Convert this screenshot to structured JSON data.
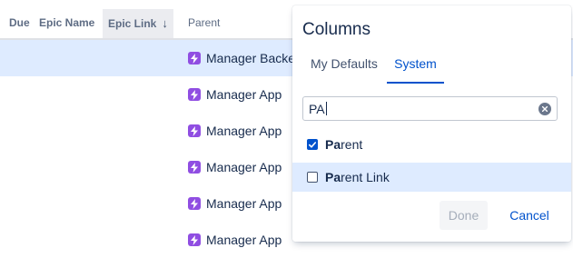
{
  "table": {
    "headers": {
      "due": "Due",
      "epic_name": "Epic Name",
      "epic_link": "Epic Link",
      "epic_link_sort": "↓",
      "parent": "Parent"
    },
    "rows": [
      {
        "parent": "Manager Backe",
        "selected": true
      },
      {
        "parent": "Manager App"
      },
      {
        "parent": "Manager App"
      },
      {
        "parent": "Manager App"
      },
      {
        "parent": "Manager App"
      },
      {
        "parent": "Manager App"
      }
    ]
  },
  "columns_popup": {
    "title": "Columns",
    "tabs": [
      {
        "label": "My Defaults",
        "active": false
      },
      {
        "label": "System",
        "active": true
      }
    ],
    "search": {
      "value": "PA"
    },
    "options": [
      {
        "match": "Pa",
        "rest": "rent",
        "checked": true
      },
      {
        "match": "Pa",
        "rest": "rent Link",
        "checked": false,
        "highlighted": true
      }
    ],
    "buttons": {
      "done": "Done",
      "cancel": "Cancel"
    }
  },
  "icons": {
    "epic": "lightning-icon",
    "clear": "clear-icon",
    "check": "check-icon"
  },
  "colors": {
    "accent": "#0052cc",
    "epic": "#904ee2",
    "row_selected": "#deebff"
  }
}
